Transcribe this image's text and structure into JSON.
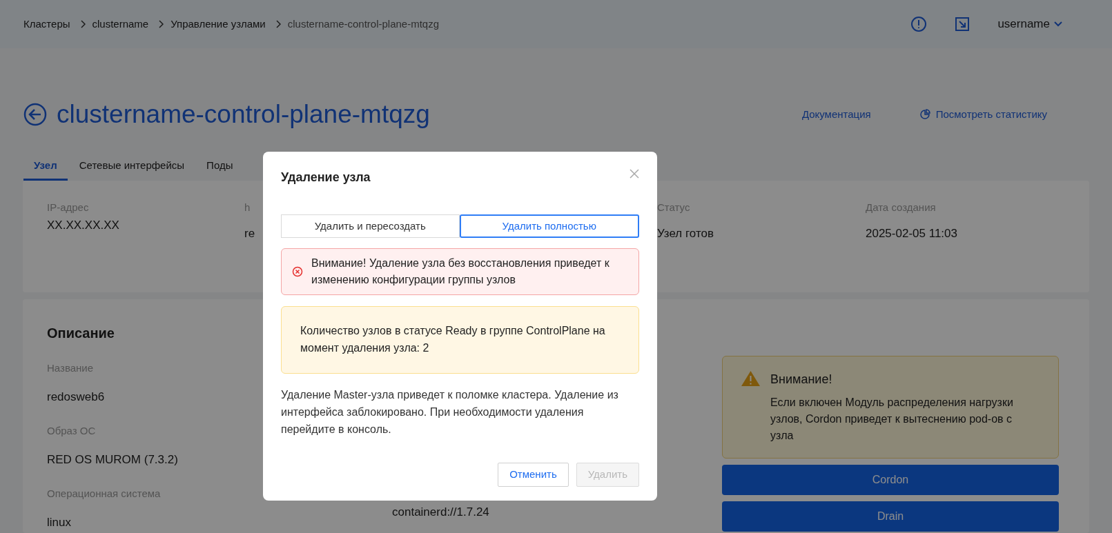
{
  "header": {
    "breadcrumbs": [
      "Кластеры",
      "clustername",
      "Управление узлами",
      "clustername-control-plane-mtqzg"
    ],
    "username": "username"
  },
  "page": {
    "title": "clustername-control-plane-mtqzg",
    "links": [
      {
        "kind": "docs",
        "label": "Документация"
      },
      {
        "kind": "stats",
        "label": "Посмотреть статистику"
      }
    ],
    "tabs": [
      {
        "label": "Узел",
        "selected": true
      },
      {
        "label": "Сетевые интерфейсы",
        "selected": false
      },
      {
        "label": "Поды",
        "selected": false
      }
    ],
    "info_fields": [
      {
        "label": "IP-адрес",
        "value": "XX.XX.XX.XX"
      },
      {
        "label": "h",
        "value": "re"
      },
      {
        "label": "Статус",
        "value": "Узел готов"
      },
      {
        "label": "Дата создания",
        "value": "2025-02-05 11:03"
      }
    ],
    "description": {
      "title": "Описание",
      "fields": [
        {
          "label": "Название",
          "value": "redosweb6"
        },
        {
          "label": "Образ ОС",
          "value": "RED OS MUROM (7.3.2)"
        },
        {
          "label": "Операционная система",
          "value": "linux"
        }
      ],
      "runtime_value": "containerd://1.7.24"
    },
    "notice": {
      "title": "Внимание!",
      "text": "Если включен Модуль распределения нагрузки узлов, Cordon приведет к вытеснению pod-ов с узла"
    },
    "actions": [
      "Cordon",
      "Drain"
    ]
  },
  "dialog": {
    "title": "Удаление узла",
    "segments": [
      {
        "label": "Удалить и пересоздать",
        "selected": false
      },
      {
        "label": "Удалить полностью",
        "selected": true
      }
    ],
    "error": "Внимание! Удаление узла без восстановления приведет к изменению конфигурации группы узлов",
    "info": "Количество узлов в статусе Ready в группе ControlPlane на момент удаления узла: 2",
    "body": "Удаление Master-узла приведет к поломке кластера. Удаление из интерфейса заблокировано. При необходимости удаления перейдите в консоль.",
    "buttons": [
      {
        "label": "Отменить",
        "kind": "secondary",
        "disabled": false
      },
      {
        "label": "Удалить",
        "kind": "primary",
        "disabled": true
      }
    ]
  }
}
